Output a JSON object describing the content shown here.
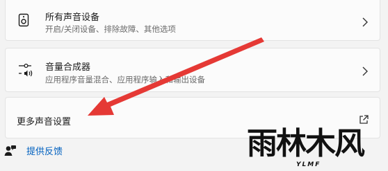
{
  "rows": [
    {
      "title": "所有声音设备",
      "subtitle": "开启/关闭设备、排除故障、其他选项",
      "icon": "speaker-icon"
    },
    {
      "title": "音量合成器",
      "subtitle": "应用程序音量混合、应用程序输入和输出设备",
      "icon": "volume-mixer-icon"
    }
  ],
  "more_settings": {
    "title": "更多声音设置",
    "icon": "external-link-icon"
  },
  "feedback": {
    "label": "提供反馈",
    "icon": "feedback-icon"
  },
  "annotation": {
    "arrow_color": "#e53935"
  },
  "watermark": {
    "main": "雨林木风",
    "sub": "YLMF"
  },
  "colors": {
    "background": "#f3f3f3",
    "card": "#fbfbfb",
    "link": "#0060bf"
  }
}
